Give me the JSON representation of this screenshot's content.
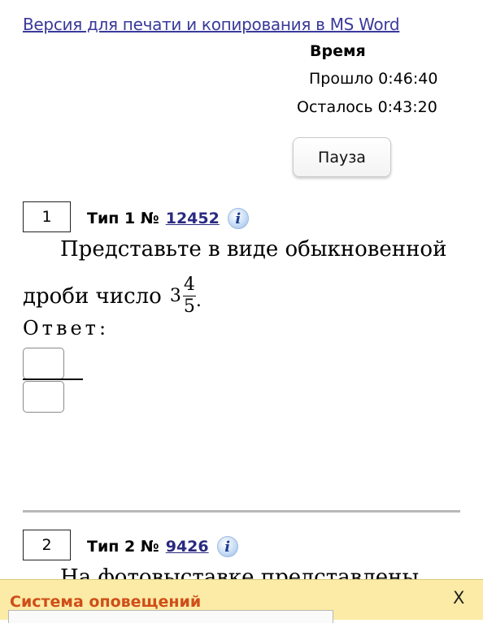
{
  "print_link": "Версия для печати и копирования в MS Word",
  "timer": {
    "title": "Время",
    "elapsed": "Прошло 0:46:40",
    "remaining": "Осталось 0:43:20",
    "pause_label": "Пауза"
  },
  "tasks": [
    {
      "number": "1",
      "type_label": "Тип 1 №",
      "id": "12452",
      "text_line1": "Представьте в виде обыкновенной",
      "text_line2": "дроби число",
      "mixed_whole": "3",
      "mixed_num": "4",
      "mixed_den": "5",
      "answer_label": "Ответ:"
    },
    {
      "number": "2",
      "type_label": "Тип 2 №",
      "id": "9426",
      "text_start": "На фотовыставке представлены"
    }
  ],
  "notification": {
    "title": "Система оповещений",
    "close_label": "X"
  },
  "colors": {
    "link": "#3a3a9a",
    "notify_bg": "#fbeba6",
    "notify_title": "#cf4e18"
  }
}
